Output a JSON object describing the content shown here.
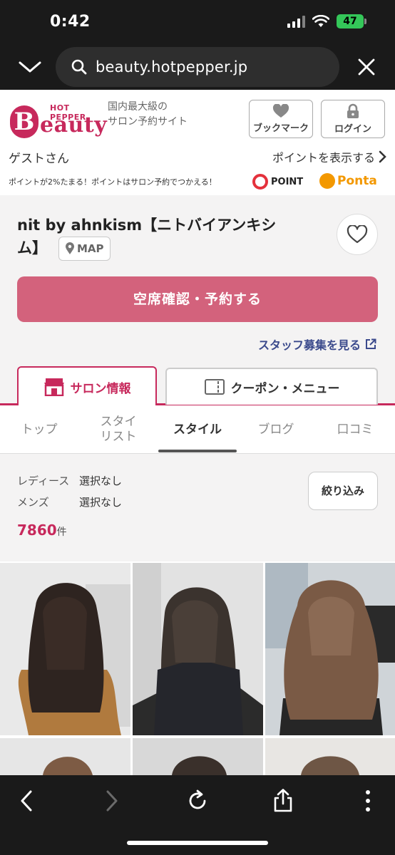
{
  "status": {
    "time": "0:42",
    "battery": "47"
  },
  "browser": {
    "url": "beauty.hotpepper.jp"
  },
  "header": {
    "logo_top": "HOT PEPPER",
    "logo_b": "B",
    "logo_rest": "eauty",
    "tagline_line1": "国内最大級の",
    "tagline_line2": "サロン予約サイト",
    "bookmark_label": "ブックマーク",
    "login_label": "ログイン",
    "guest": "ゲストさん",
    "show_points": "ポイントを表示する",
    "point_message": "ポイントが2%たまる！ポイントはサロン予約でつかえる！",
    "dpoint_label": "POINT",
    "ponta_label": "Ponta"
  },
  "salon": {
    "name": "nit by ahnkism【ニトバイアンキシム】",
    "map_label": "MAP",
    "reserve_label": "空席確認・予約する",
    "staff_link": "スタッフ募集を見る"
  },
  "main_tabs": [
    {
      "label": "サロン情報",
      "active": true
    },
    {
      "label": "クーポン・メニュー",
      "active": false
    }
  ],
  "sub_tabs": [
    {
      "label": "トップ"
    },
    {
      "label": "スタイ\nリスト"
    },
    {
      "label": "スタイル",
      "active": true
    },
    {
      "label": "ブログ"
    },
    {
      "label": "口コミ"
    }
  ],
  "filter": {
    "ladies_label": "レディース",
    "ladies_value": "選択なし",
    "mens_label": "メンズ",
    "mens_value": "選択なし",
    "narrow_button": "絞り込み",
    "count": "7860",
    "count_unit": "件"
  },
  "colors": {
    "brand": "#c7295c",
    "reserve_button": "#d3627c",
    "link": "#3b4a8c"
  }
}
